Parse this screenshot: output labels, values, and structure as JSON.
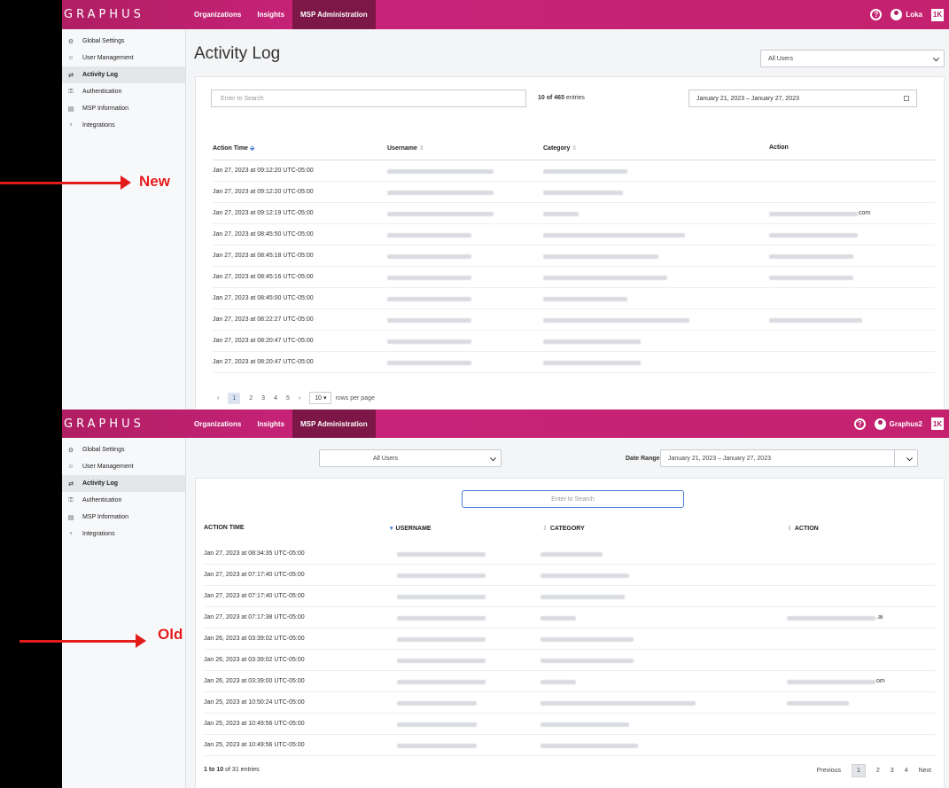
{
  "new_panel": {
    "logo": "GRAPHUS",
    "nav": [
      "Organizations",
      "Insights",
      "MSP Administration"
    ],
    "user": "Loka",
    "help": "?",
    "badge": "1K",
    "sidebar": [
      "Global Settings",
      "User Management",
      "Activity Log",
      "Authentication",
      "MSP Information",
      "Integrations"
    ],
    "title": "Activity Log",
    "user_filter": "All Users",
    "search_placeholder": "Enter to Search",
    "entries_prefix": "10 of 465",
    "entries_suffix": "entries",
    "date_range": "January 21, 2023  –  January 27, 2023",
    "headers": [
      "Action Time",
      "Username",
      "Category",
      "Action"
    ],
    "rows": [
      {
        "time": "Jan 27, 2023 at 09:12:20 UTC-05:00",
        "action_suffix": ""
      },
      {
        "time": "Jan 27, 2023 at 09:12:20 UTC-05:00",
        "action_suffix": ""
      },
      {
        "time": "Jan 27, 2023 at 09:12:19 UTC-05:00",
        "action_suffix": "com"
      },
      {
        "time": "Jan 27, 2023 at 08:45:50 UTC-05:00",
        "action_suffix": ""
      },
      {
        "time": "Jan 27, 2023 at 08:45:18 UTC-05:00",
        "action_suffix": ""
      },
      {
        "time": "Jan 27, 2023 at 08:45:16 UTC-05:00",
        "action_suffix": ""
      },
      {
        "time": "Jan 27, 2023 at 08:45:00 UTC-05:00",
        "action_suffix": ""
      },
      {
        "time": "Jan 27, 2023 at 08:22:27 UTC-05:00",
        "action_suffix": ""
      },
      {
        "time": "Jan 27, 2023 at 08:20:47 UTC-05:00",
        "action_suffix": ""
      },
      {
        "time": "Jan 27, 2023 at 08:20:47 UTC-05:00",
        "action_suffix": ""
      }
    ],
    "pager": {
      "prev": "‹",
      "pages": [
        "1",
        "2",
        "3",
        "4",
        "5"
      ],
      "next": "›",
      "rows": "10",
      "rows_label": "rows per page"
    }
  },
  "old_panel": {
    "logo": "GRAPHUS",
    "nav": [
      "Organizations",
      "Insights",
      "MSP Administration"
    ],
    "user": "Graphus2",
    "help": "?",
    "badge": "1K",
    "sidebar": [
      "Global Settings",
      "User Management",
      "Activity Log",
      "Authentication",
      "MSP Information",
      "Integrations"
    ],
    "user_filter": "All Users",
    "date_label": "Date Range:",
    "date_range": "January 21, 2023  –  January 27, 2023",
    "search_placeholder": "Enter to Search",
    "headers": [
      "ACTION TIME",
      "USERNAME",
      "CATEGORY",
      "ACTION"
    ],
    "rows": [
      {
        "time": "Jan 27, 2023 at 08:34:35 UTC-05:00",
        "action_suffix": ""
      },
      {
        "time": "Jan 27, 2023 at 07:17:40 UTC-05:00",
        "action_suffix": ""
      },
      {
        "time": "Jan 27, 2023 at 07:17:40 UTC-05:00",
        "action_suffix": ""
      },
      {
        "time": "Jan 27, 2023 at 07:17:38 UTC-05:00",
        "action_suffix": ".ai"
      },
      {
        "time": "Jan 26, 2023 at 03:39:02 UTC-05:00",
        "action_suffix": ""
      },
      {
        "time": "Jan 26, 2023 at 03:39:02 UTC-05:00",
        "action_suffix": ""
      },
      {
        "time": "Jan 26, 2023 at 03:39:00 UTC-05:00",
        "action_suffix": "om"
      },
      {
        "time": "Jan 25, 2023 at 10:50:24 UTC-05:00",
        "action_suffix": ""
      },
      {
        "time": "Jan 25, 2023 at 10:49:56 UTC-05:00",
        "action_suffix": ""
      },
      {
        "time": "Jan 25, 2023 at 10:49:56 UTC-05:00",
        "action_suffix": ""
      }
    ],
    "footer_range": "1 to 10",
    "footer_rest": "of 31 entries",
    "pager": {
      "prev": "Previous",
      "pages": [
        "1",
        "2",
        "3",
        "4"
      ],
      "next": "Next"
    }
  },
  "annotations": {
    "new": "New",
    "old": "Old"
  }
}
